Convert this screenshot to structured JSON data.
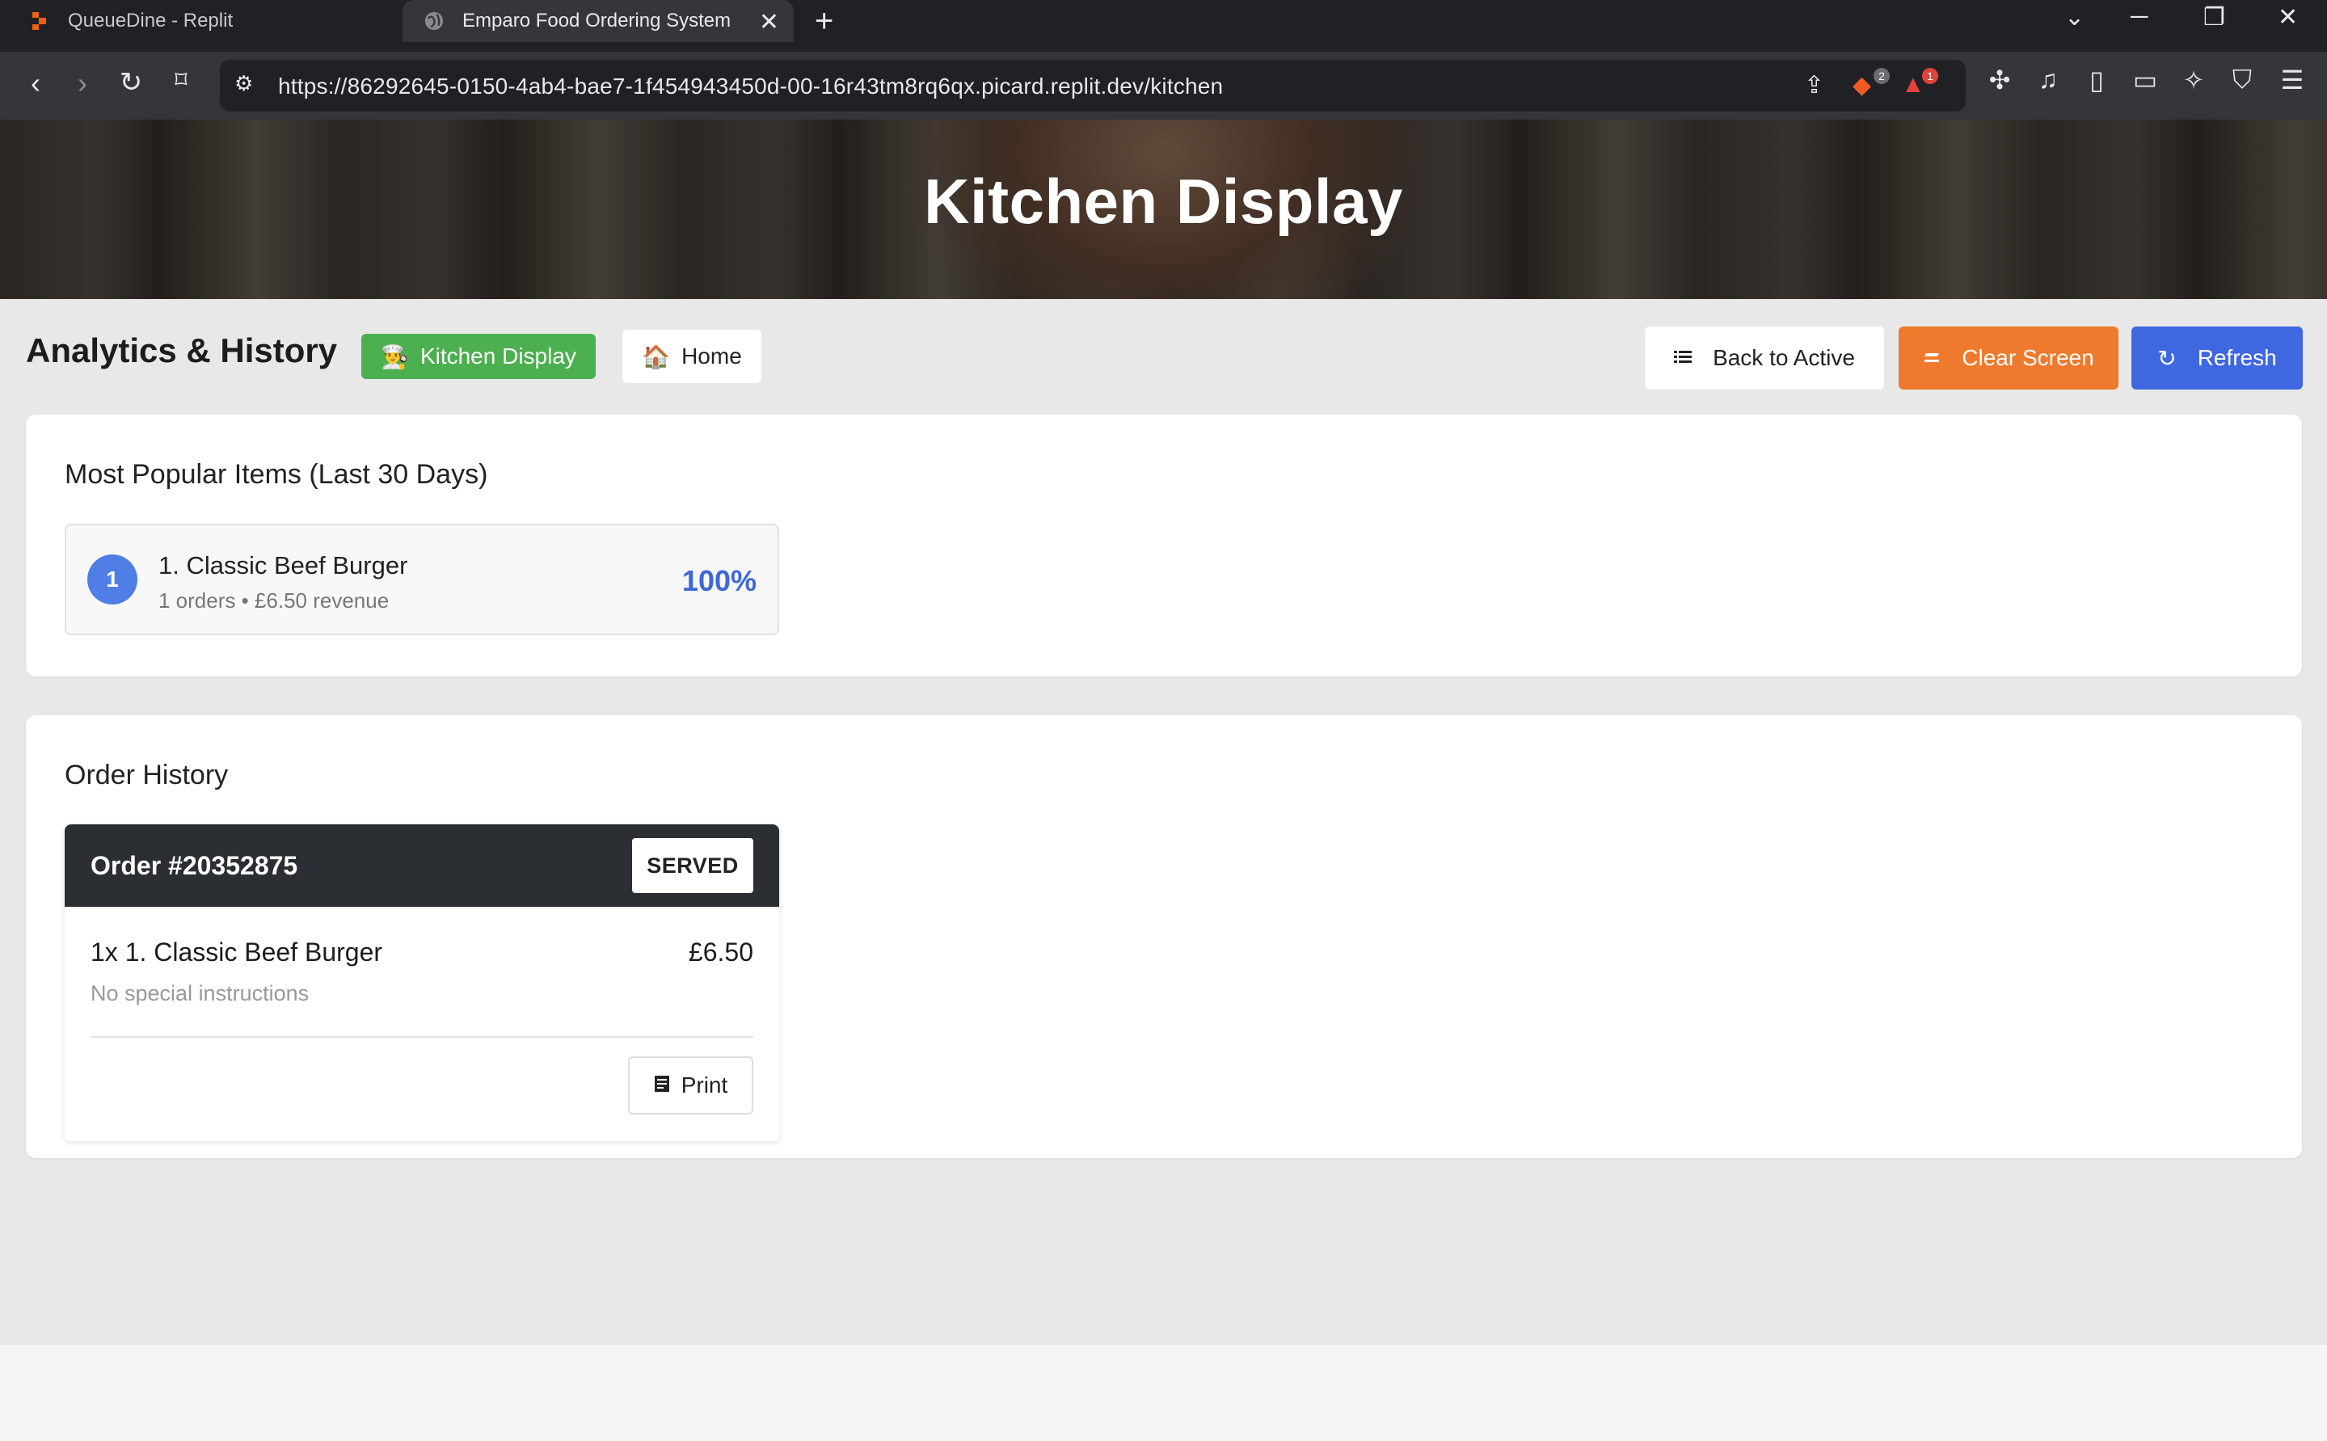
{
  "browser": {
    "tabs": [
      {
        "title": "QueueDine - Replit",
        "active": false,
        "favicon": "replit-icon"
      },
      {
        "title": "Emparo Food Ordering System",
        "active": true,
        "favicon": "globe-icon"
      }
    ],
    "url": "https://86292645-0150-4ab4-bae7-1f454943450d-00-16r43tm8rq6qx.picard.replit.dev/kitchen",
    "badges": {
      "brave_shield": "2",
      "brave_rewards": "1"
    },
    "colors": {
      "tabbar": "#202124",
      "toolbar": "#35363a"
    }
  },
  "hero": {
    "title": "Kitchen Display"
  },
  "toolbar": {
    "heading": "Analytics & History",
    "kitchen_display_label": "Kitchen Display",
    "home_label": "Home",
    "back_label": "Back to Active",
    "clear_label": "Clear Screen",
    "refresh_label": "Refresh",
    "colors": {
      "kitchen": "#4caf50",
      "clear": "#ef7a2d",
      "refresh": "#3f67e0"
    }
  },
  "popular": {
    "title": "Most Popular Items (Last 30 Days)",
    "items": [
      {
        "rank": "1",
        "name": "1. Classic Beef Burger",
        "sub": "1 orders • £6.50 revenue",
        "percent": "100%"
      }
    ]
  },
  "history": {
    "title": "Order History",
    "orders": [
      {
        "number": "Order #20352875",
        "status": "SERVED",
        "items": [
          {
            "line": "1x 1. Classic Beef Burger",
            "price": "£6.50",
            "note": "No special instructions"
          }
        ],
        "print_label": "Print"
      }
    ]
  }
}
